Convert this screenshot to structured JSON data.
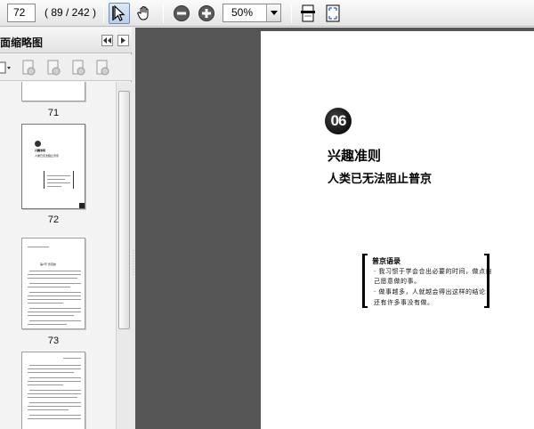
{
  "toolbar": {
    "page_number": "72",
    "page_count": "( 89 / 242 )",
    "zoom_value": "50%",
    "icons": [
      "select-arrow-icon",
      "hand-icon",
      "zoom-out-icon",
      "zoom-in-icon",
      "fit-width-icon",
      "fit-page-icon"
    ]
  },
  "panel": {
    "title": "面缩略图",
    "thumbnails": [
      {
        "label": "71"
      },
      {
        "label": "72",
        "heading": "兴趣准则",
        "subheading": "人类已无法阻止普京"
      },
      {
        "label": "73",
        "heading": "第1节 普京的"
      },
      {
        "label": ""
      }
    ]
  },
  "page": {
    "chapter_number": "06",
    "title": "兴趣准则",
    "subtitle": "人类已无法阻止普京",
    "quote_title": "普京语录",
    "quote_lines": [
      "· 我习惯于学会合出必要的时间，做点自",
      "  己愿意做的事。",
      "· 做事越多，人就越会得出这样的结论：",
      "  还有许多事没有做。"
    ]
  }
}
